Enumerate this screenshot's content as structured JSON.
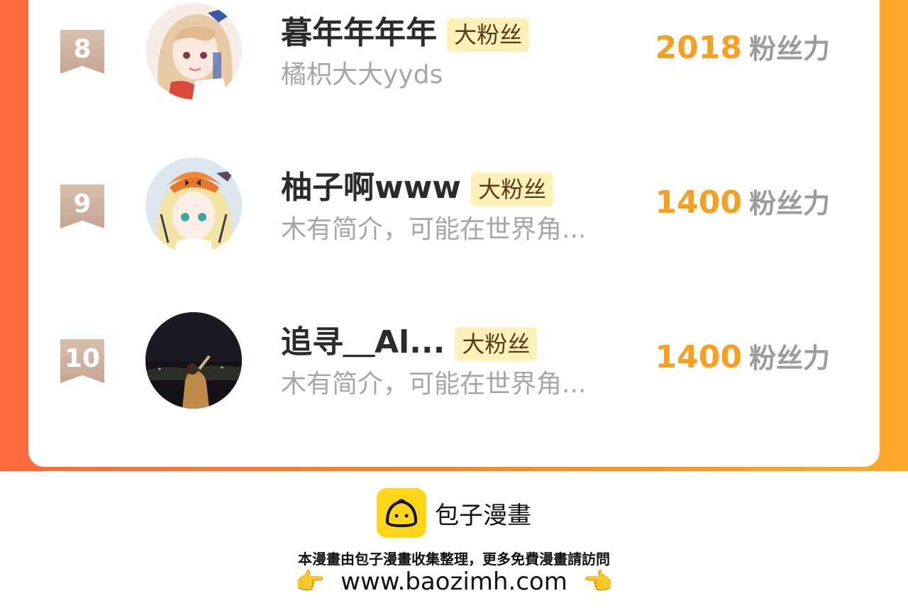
{
  "ranking": [
    {
      "rank": "8",
      "name": "暮年年年年",
      "badge": "大粉丝",
      "bio": "橘枳大大yyds",
      "score": "2018",
      "score_unit": "粉丝力",
      "avatar": "anime-girl-blue-ribbon"
    },
    {
      "rank": "9",
      "name": "柚子啊www",
      "badge": "大粉丝",
      "bio": "木有简介，可能在世界角...",
      "score": "1400",
      "score_unit": "粉丝力",
      "avatar": "anime-girl-pumpkin-hat"
    },
    {
      "rank": "10",
      "name": "追寻＿Al...",
      "badge": "大粉丝",
      "bio": "木有简介，可能在世界角...",
      "score": "1400",
      "score_unit": "粉丝力",
      "avatar": "night-photo-person"
    }
  ],
  "footer": {
    "logo_icon": "bun-logo-icon",
    "brand": "包子漫畫",
    "notice": "本漫畫由包子漫畫收集整理，更多免費漫畫請訪問",
    "url": "www.baozimh.com",
    "hand_left": "👉",
    "hand_right": "👈"
  },
  "colors": {
    "band_start": "#ff6a3d",
    "band_end": "#ffa928",
    "score": "#f5a020",
    "badge_bg": "#fff1b8",
    "logo_bg": "#ffd51c"
  }
}
